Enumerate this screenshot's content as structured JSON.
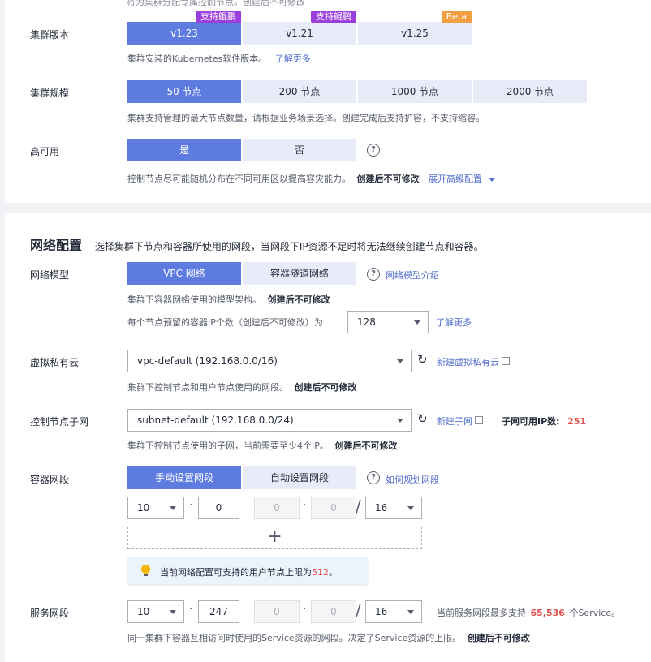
{
  "top_card": {
    "partial_text": "将为集群分配专属控制节点。创建后不可修改",
    "cluster_version": {
      "label": "集群版本",
      "options": [
        {
          "label": "v1.23",
          "badge": "支持鲲鹏",
          "active": true
        },
        {
          "label": "v1.21",
          "badge": "支持鲲鹏",
          "active": false
        },
        {
          "label": "v1.25",
          "badge": "Beta",
          "active": false
        }
      ],
      "help": "集群安装的Kubernetes软件版本。",
      "help_link": "了解更多"
    },
    "cluster_scale": {
      "label": "集群规模",
      "options": [
        {
          "label": "50 节点",
          "active": true
        },
        {
          "label": "200 节点",
          "active": false
        },
        {
          "label": "1000 节点",
          "active": false
        },
        {
          "label": "2000 节点",
          "active": false
        }
      ],
      "help": "集群支持管理的最大节点数量，请根据业务场景选择。创建完成后支持扩容，不支持缩容。"
    },
    "high_availability": {
      "label": "高可用",
      "options": [
        {
          "label": "是",
          "active": true
        },
        {
          "label": "否",
          "active": false
        }
      ],
      "help": "控制节点尽可能随机分布在不同可用区以提高容灾能力。",
      "help_bold": "创建后不可修改",
      "advanced_link": "展开高级配置"
    }
  },
  "network": {
    "title": "网络配置",
    "subtitle": "选择集群下节点和容器所使用的网段，当网段下IP资源不足时将无法继续创建节点和容器。",
    "model": {
      "label": "网络模型",
      "options": [
        {
          "label": "VPC 网络",
          "active": true
        },
        {
          "label": "容器隧道网络",
          "active": false
        }
      ],
      "help_link": "网络模型介绍",
      "help": "集群下容器网络使用的模型架构。",
      "help_bold": "创建后不可修改",
      "pod_ip_text": "每个节点预留的容器IP个数（创建后不可修改）为",
      "pod_ip_value": "128",
      "pod_ip_link": "了解更多"
    },
    "vpc": {
      "label": "虚拟私有云",
      "value": "vpc-default (192.168.0.0/16)",
      "create_link": "新建虚拟私有云",
      "help": "集群下控制节点和用户节点使用的网段。",
      "help_bold": "创建后不可修改"
    },
    "subnet": {
      "label": "控制节点子网",
      "value": "subnet-default (192.168.0.0/24)",
      "create_link": "新建子网",
      "available_label": "子网可用IP数:",
      "available_value": "251",
      "help": "集群下控制节点使用的子网，当前需要至少4个IP。",
      "help_bold": "创建后不可修改"
    },
    "container_cidr": {
      "label": "容器网段",
      "options": [
        {
          "label": "手动设置网段",
          "active": true
        },
        {
          "label": "自动设置网段",
          "active": false
        }
      ],
      "help_link": "如何规划网段",
      "octet1": "10",
      "octet2": "0",
      "octet3": "0",
      "octet4": "0",
      "mask": "16",
      "add_icon": "+",
      "tip_prefix": "当前网络配置可支持的用户节点上限为",
      "tip_value": "512",
      "tip_suffix": "。"
    },
    "service_cidr": {
      "label": "服务网段",
      "octet1": "10",
      "octet2": "247",
      "octet3": "0",
      "octet4": "0",
      "mask": "16",
      "max_prefix": "当前服务网段最多支持",
      "max_value": "65,536",
      "max_suffix": "个Service。",
      "help": "同一集群下容器互相访问时使用的Service资源的网段。决定了Service资源的上限。",
      "help_bold": "创建后不可修改"
    }
  }
}
